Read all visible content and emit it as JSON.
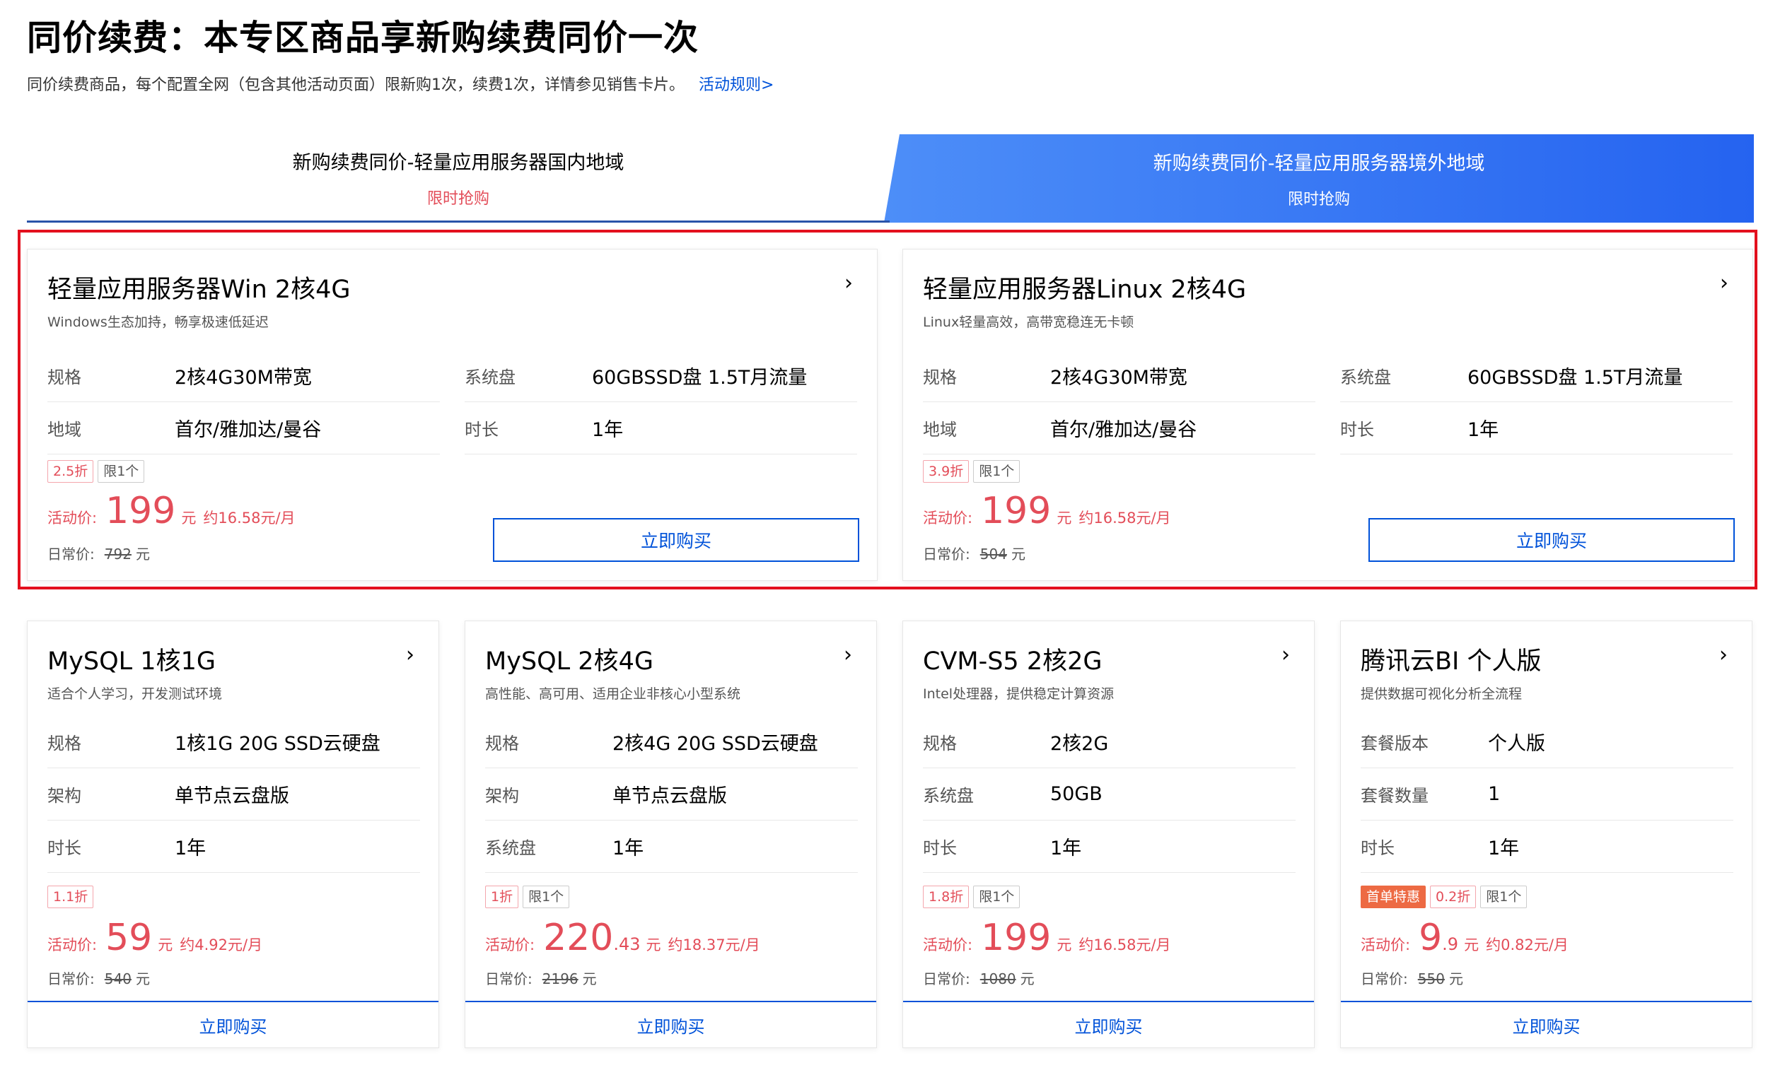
{
  "header": {
    "title": "同价续费：本专区商品享新购续费同价一次",
    "description": "同价续费商品，每个配置全网（包含其他活动页面）限新购1次，续费1次，详情参见销售卡片。",
    "rules_link": "活动规则>"
  },
  "tabs": [
    {
      "title": "新购续费同价-轻量应用服务器国内地域",
      "subtitle": "限时抢购",
      "active": false
    },
    {
      "title": "新购续费同价-轻量应用服务器境外地域",
      "subtitle": "限时抢购",
      "active": true
    }
  ],
  "colors": {
    "accent": "#0052d9",
    "price": "#e34d59",
    "tab_active": "#2f6ef7",
    "highlight": "#e3101e"
  },
  "icons": {
    "arrow": "chevron-right-icon"
  },
  "labels": {
    "price_label": "活动价:",
    "orig_label": "日常价:",
    "yuan": "元",
    "buy": "立即购买"
  },
  "big_cards": [
    {
      "title": "轻量应用服务器Win 2核4G",
      "subtitle": "Windows生态加持，畅享极速低延迟",
      "specs": [
        {
          "key": "规格",
          "value": "2核4G30M带宽"
        },
        {
          "key": "系统盘",
          "value": "60GBSSD盘 1.5T月流量"
        },
        {
          "key": "地域",
          "value": "首尔/雅加达/曼谷"
        },
        {
          "key": "时长",
          "value": "1年"
        }
      ],
      "discount": "2.5折",
      "limit": "限1个",
      "price_int": "199",
      "price_dec": "",
      "per_month": "约16.58元/月",
      "orig_price": "792"
    },
    {
      "title": "轻量应用服务器Linux 2核4G",
      "subtitle": "Linux轻量高效，高带宽稳连无卡顿",
      "specs": [
        {
          "key": "规格",
          "value": "2核4G30M带宽"
        },
        {
          "key": "系统盘",
          "value": "60GBSSD盘 1.5T月流量"
        },
        {
          "key": "地域",
          "value": "首尔/雅加达/曼谷"
        },
        {
          "key": "时长",
          "value": "1年"
        }
      ],
      "discount": "3.9折",
      "limit": "限1个",
      "price_int": "199",
      "price_dec": "",
      "per_month": "约16.58元/月",
      "orig_price": "504"
    }
  ],
  "small_cards": [
    {
      "title": "MySQL 1核1G",
      "subtitle": "适合个人学习，开发测试环境",
      "specs": [
        {
          "key": "规格",
          "value": "1核1G 20G SSD云硬盘"
        },
        {
          "key": "架构",
          "value": "单节点云盘版"
        },
        {
          "key": "时长",
          "value": "1年"
        }
      ],
      "first": "",
      "discount": "1.1折",
      "limit": "",
      "price_int": "59",
      "price_dec": "",
      "per_month": "约4.92元/月",
      "orig_price": "540"
    },
    {
      "title": "MySQL 2核4G",
      "subtitle": "高性能、高可用、适用企业非核心小型系统",
      "specs": [
        {
          "key": "规格",
          "value": "2核4G 20G SSD云硬盘"
        },
        {
          "key": "架构",
          "value": "单节点云盘版"
        },
        {
          "key": "系统盘",
          "value": "1年"
        }
      ],
      "first": "",
      "discount": "1折",
      "limit": "限1个",
      "price_int": "220",
      "price_dec": ".43",
      "per_month": "约18.37元/月",
      "orig_price": "2196"
    },
    {
      "title": "CVM-S5 2核2G",
      "subtitle": "Intel处理器，提供稳定计算资源",
      "specs": [
        {
          "key": "规格",
          "value": "2核2G"
        },
        {
          "key": "系统盘",
          "value": "50GB"
        },
        {
          "key": "时长",
          "value": "1年"
        }
      ],
      "first": "",
      "discount": "1.8折",
      "limit": "限1个",
      "price_int": "199",
      "price_dec": "",
      "per_month": "约16.58元/月",
      "orig_price": "1080"
    },
    {
      "title": "腾讯云BI 个人版",
      "subtitle": "提供数据可视化分析全流程",
      "specs": [
        {
          "key": "套餐版本",
          "value": "个人版"
        },
        {
          "key": "套餐数量",
          "value": "1"
        },
        {
          "key": "时长",
          "value": "1年"
        }
      ],
      "first": "首单特惠",
      "discount": "0.2折",
      "limit": "限1个",
      "price_int": "9",
      "price_dec": ".9",
      "per_month": "约0.82元/月",
      "orig_price": "550"
    }
  ]
}
